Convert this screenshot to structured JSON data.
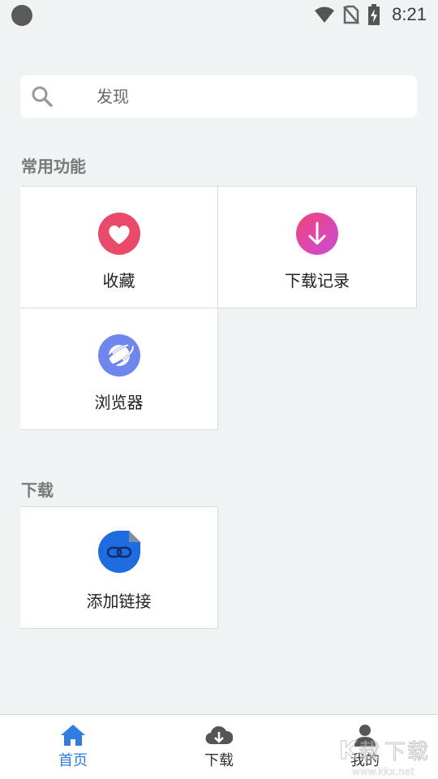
{
  "status_bar": {
    "time": "8:21",
    "icons": [
      "wifi-icon",
      "no-sim-icon",
      "battery-charging-icon"
    ]
  },
  "search": {
    "placeholder": "发现",
    "icon": "search-icon"
  },
  "sections": {
    "common": {
      "title": "常用功能",
      "items": [
        {
          "label": "收藏",
          "icon": "heart-icon",
          "color": "#e94a6a"
        },
        {
          "label": "下载记录",
          "icon": "download-arrow-icon",
          "color": "#e8477a"
        },
        {
          "label": "浏览器",
          "icon": "planet-browser-icon",
          "color": "#6f86ee"
        }
      ]
    },
    "download": {
      "title": "下载",
      "items": [
        {
          "label": "添加链接",
          "icon": "link-icon",
          "color": "#1f6be0"
        }
      ]
    }
  },
  "bottom_nav": {
    "items": [
      {
        "label": "首页",
        "icon": "home-icon",
        "active": true
      },
      {
        "label": "下载",
        "icon": "cloud-download-icon",
        "active": false
      },
      {
        "label": "我的",
        "icon": "user-icon",
        "active": false
      }
    ],
    "active_color": "#2f7de1",
    "inactive_color": "#333333"
  },
  "watermark": {
    "text": "下载",
    "url": "www.kkx.net"
  }
}
